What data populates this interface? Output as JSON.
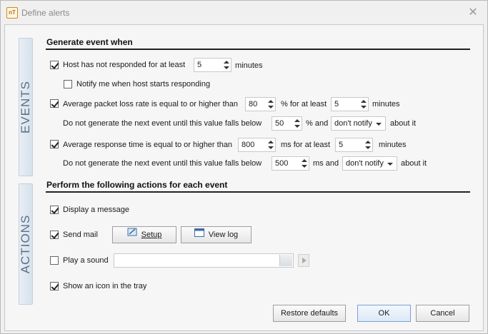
{
  "window": {
    "title": "Define alerts",
    "app_icon_text": "nT"
  },
  "tabs": {
    "events": "EVENTS",
    "actions": "ACTIONS"
  },
  "events": {
    "heading": "Generate event when",
    "host_not_responded": {
      "label": "Host has not responded for at least",
      "value": "5",
      "unit": "minutes",
      "checked": true
    },
    "notify_host_starts": {
      "label": "Notify me when host starts responding",
      "checked": false
    },
    "packet_loss": {
      "label": "Average packet loss rate is equal to or higher than",
      "value": "80",
      "unit_mid": "% for at least",
      "value2": "5",
      "unit": "minutes",
      "checked": true
    },
    "packet_loss_hold": {
      "label": "Do not generate the next event until this value falls below",
      "value": "50",
      "unit": "% and",
      "combo": "don't notify",
      "suffix": "about it"
    },
    "response_time": {
      "label": "Average response time is equal to or higher than",
      "value": "800",
      "unit_mid": "ms for at least",
      "value2": "5",
      "unit": "minutes",
      "checked": true
    },
    "response_time_hold": {
      "label": "Do not generate the next event until this value falls below",
      "value": "500",
      "unit": "ms and",
      "combo": "don't notify",
      "suffix": "about it"
    }
  },
  "actions": {
    "heading": "Perform the following actions for each event",
    "display_message": {
      "label": "Display a message",
      "checked": true
    },
    "send_mail": {
      "label": "Send mail",
      "checked": true
    },
    "setup_button": "Setup",
    "view_log_button": "View log",
    "play_sound": {
      "label": "Play a sound",
      "checked": false,
      "path": ""
    },
    "tray_icon": {
      "label": "Show an icon in the tray",
      "checked": true
    }
  },
  "buttons": {
    "restore": "Restore defaults",
    "ok": "OK",
    "cancel": "Cancel"
  }
}
